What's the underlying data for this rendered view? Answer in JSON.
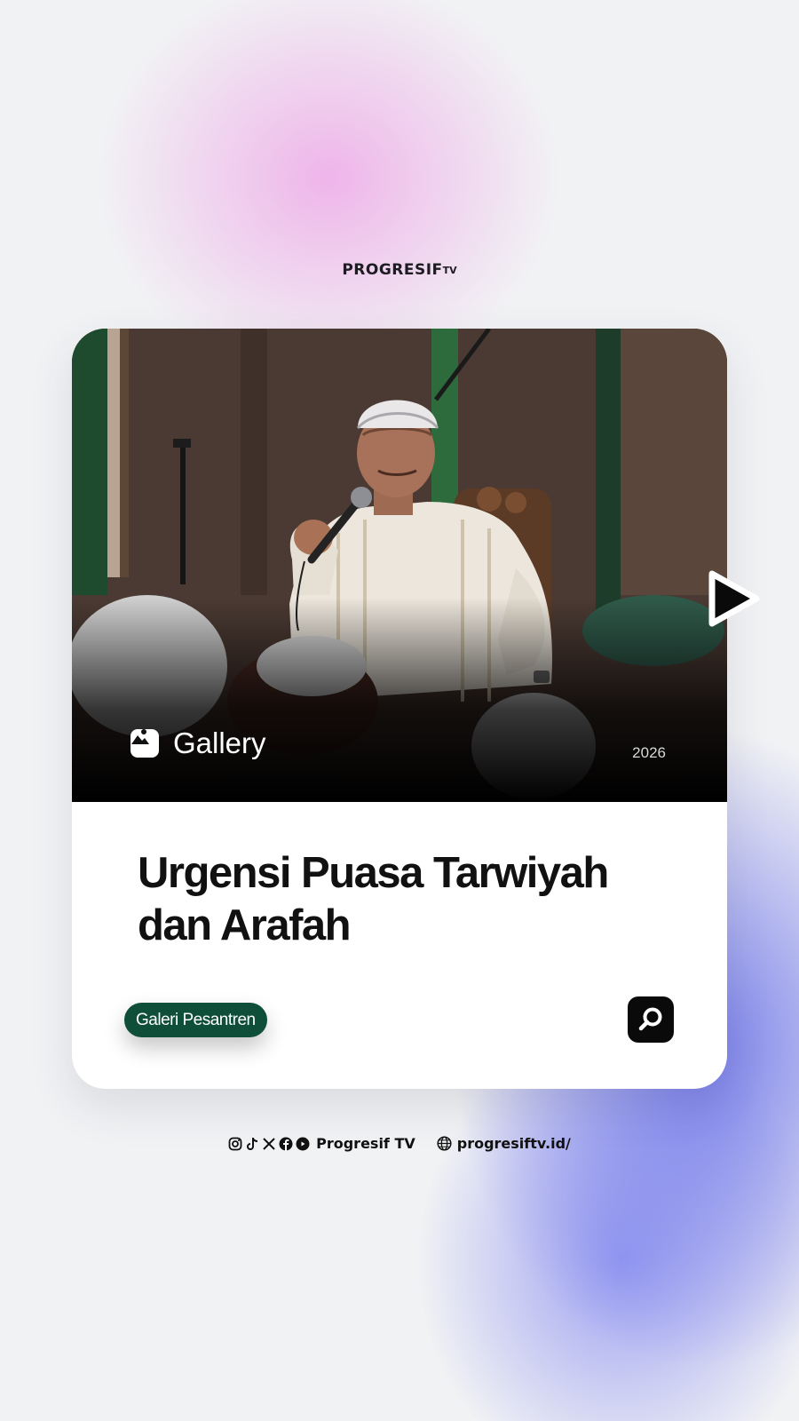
{
  "brand": {
    "name": "PROGRESIF",
    "suffix": "TV"
  },
  "card": {
    "media_type_label": "Gallery",
    "year": "2026",
    "title": "Urgensi Puasa Tarwiyah dan Arafah",
    "category": "Galeri Pesantren",
    "icons": {
      "media": "image-icon",
      "search": "search-icon",
      "play": "play-icon"
    }
  },
  "footer": {
    "social_icons": [
      "instagram-icon",
      "tiktok-icon",
      "x-icon",
      "facebook-icon",
      "youtube-icon"
    ],
    "handle": "Progresif TV",
    "website": "progresiftv.id/"
  },
  "colors": {
    "background": "#f1f2f4",
    "pink_glow": "#eeaae8",
    "blue_glow": "#6269e8",
    "category_green": "#0f4e38",
    "title_text": "#111111"
  }
}
